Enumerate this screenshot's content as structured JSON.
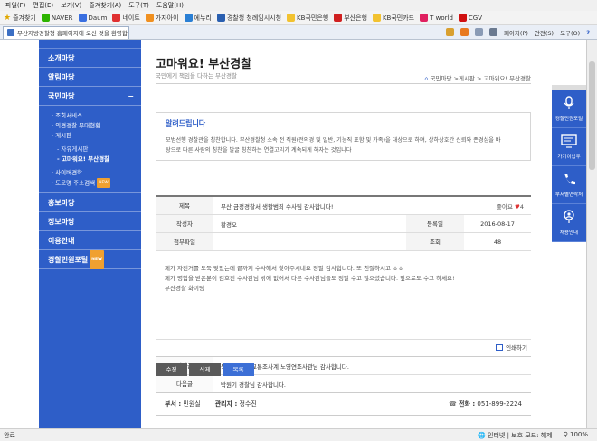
{
  "browser": {
    "menu": [
      "파일(F)",
      "편집(E)",
      "보기(V)",
      "즐겨찾기(A)",
      "도구(T)",
      "도움말(H)"
    ],
    "favorites_label": "즐겨찾기",
    "favorites": [
      {
        "label": "NAVER",
        "color": "#2db400"
      },
      {
        "label": "Daum",
        "color": "#3a6fe0"
      },
      {
        "label": "네이트",
        "color": "#e03030"
      },
      {
        "label": "가자아이",
        "color": "#f09020"
      },
      {
        "label": "에누리",
        "color": "#2a7fd4"
      },
      {
        "label": "경찰청 청례임시시청",
        "color": "#2a5fb0"
      },
      {
        "label": "KB국민은행",
        "color": "#f2c230"
      },
      {
        "label": "부산은행",
        "color": "#d02020"
      },
      {
        "label": "KB국민카드",
        "color": "#f2c230"
      },
      {
        "label": "T world",
        "color": "#e02060"
      },
      {
        "label": "CGV",
        "color": "#d01010"
      }
    ],
    "tab_title": "부산지방경찰청 홈페이지에 오신 것을 환영합니...",
    "commands": [
      "페이지(P)",
      "안전(S)",
      "도구(O)"
    ],
    "status_left": "완료",
    "status_zone": "인터넷 | 보호 모드: 해제",
    "status_zoom": "100%"
  },
  "lnb": {
    "top_cut": "",
    "menus_before": [
      "소개마당",
      "알림마당"
    ],
    "open_menu": "국민마당",
    "open_toggle": "−",
    "sub_items": [
      "조회서비스",
      "의견경찰 부대현황",
      "게시판"
    ],
    "deep_items": [
      "자유게시판",
      "고마워요! 부산경찰"
    ],
    "sub_items_after": [
      "사이버견학"
    ],
    "sub_item_new": "도로명 주소검색",
    "new_badge": "NEW",
    "menus_after": [
      "홍보마당",
      "정보마당",
      "이용안내"
    ],
    "last_menu": "경찰민원포털",
    "last_badge": "NEW"
  },
  "content": {
    "title": "고마워요! 부산경찰",
    "subtitle": "국민에게 책임을 다하는 부산경찰",
    "breadcrumb": "국민마당 >게시판 > 고마워요! 부산경찰",
    "notice": {
      "heading": "알려드립니다",
      "line1": "모범선행 경찰관을 칭찬합니다. 부산경찰청 소속 전 직원(전의경 및 일반, 기능직 포함 및 가족)을 대상으로 하며, 상하상호간 신뢰와 존경심을 바",
      "line2": "탕으로 다른 사람의 칭찬을 발굴 칭찬하는 연결고리가 계속되게 하자는 것입니다"
    },
    "post": {
      "subject_label": "제목",
      "subject": "부산 금정경찰서 생활범죄 수사팀 감사합니다!",
      "likes_label": "좋아요",
      "likes_heart": "♥",
      "likes": "4",
      "author_label": "작성자",
      "author": "황경오",
      "date_label": "등록일",
      "date": "2016-08-17",
      "attach_label": "첨부파일",
      "attach": "",
      "views_label": "조회",
      "views": "48",
      "body1": "제가 자전거를 도둑 맞았는데 끝까지 수사해서 찾아주시네요 정말 감사합니다. 또 친절하시고 ㅎㅎ",
      "body2": "제가 명함을 받은분이 김호진 수사관님 밖에 없어서 다른 수사관님들도 정말 수고 많으셨습니다. 앞으로도 수고 하세요!",
      "body3": "부산경찰 화이팅",
      "print_label": "인쇄하기"
    },
    "prev_label": "이전글",
    "prev_title": "북부 경찰서 교통조사계 노영연조사관님 감사합니다.",
    "next_label": "다음글",
    "next_title": "박원기 경찰님 감사합니다.",
    "buttons": {
      "edit": "수정",
      "delete": "삭제",
      "list": "목록"
    },
    "footer": {
      "dept_label": "부서 :",
      "dept": "민원실",
      "manager_label": "관리자 :",
      "manager": "정수진",
      "phone_label": "전화 :",
      "phone": "051-899-2224"
    }
  },
  "quick_menu": [
    {
      "label": "경찰민원포털",
      "icon": "microphone-icon"
    },
    {
      "label": "가기이업무",
      "icon": "monitor-icon"
    },
    {
      "label": "부서별연락처",
      "icon": "phone-icon"
    },
    {
      "label": "채용안내",
      "icon": "person-icon"
    }
  ],
  "colors": {
    "accent": "#2e5ec8",
    "button_gray": "#5a5a5a",
    "button_blue": "#3c6fd6"
  }
}
